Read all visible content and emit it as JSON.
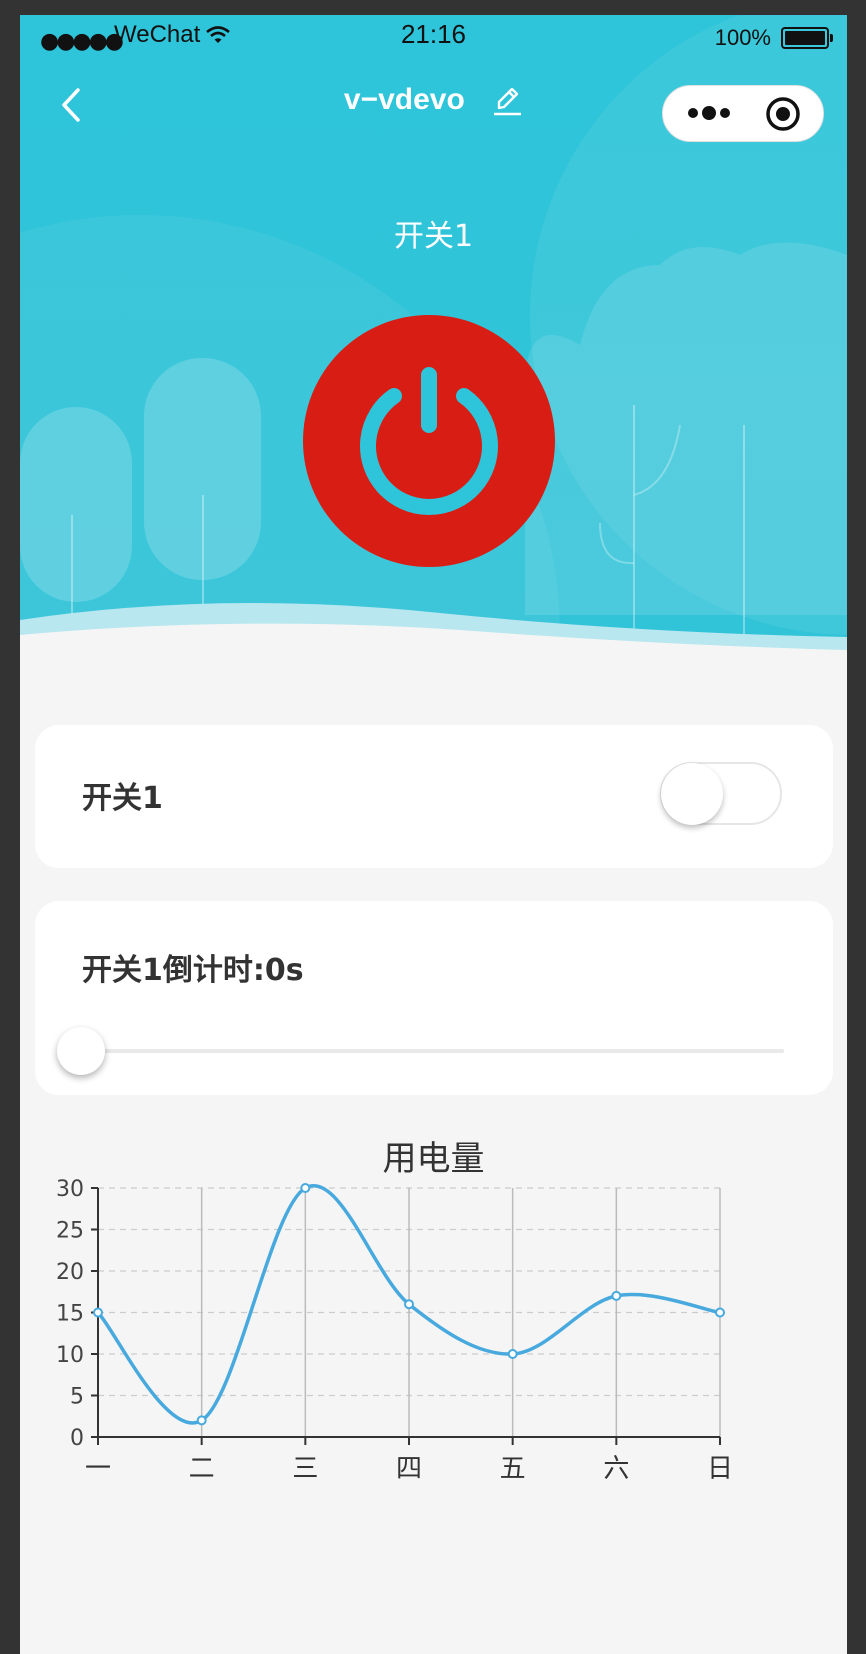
{
  "status_bar": {
    "carrier": "WeChat",
    "time": "21:16",
    "battery": "100%"
  },
  "navbar": {
    "title": "v−vdevo",
    "icons": [
      "chevron-left-icon",
      "pencil-icon",
      "more-dots-icon",
      "target-icon"
    ]
  },
  "hero": {
    "label": "开关1",
    "power_color": "#d81e14",
    "accent_color": "#2ec4d9"
  },
  "switch_card": {
    "label": "开关1",
    "on": false
  },
  "timer_card": {
    "label": "开关1倒计时:0s",
    "value": 0
  },
  "chart_title": "用电量",
  "chart_data": {
    "type": "line",
    "categories": [
      "一",
      "二",
      "三",
      "四",
      "五",
      "六",
      "日"
    ],
    "values": [
      15,
      2,
      30,
      16,
      10,
      17,
      15
    ],
    "yticks": [
      0,
      5,
      10,
      15,
      20,
      25,
      30
    ],
    "ylim": [
      0,
      30
    ],
    "smooth": true,
    "grid": "dashed-horizontal",
    "line_color": "#47a9dd"
  }
}
